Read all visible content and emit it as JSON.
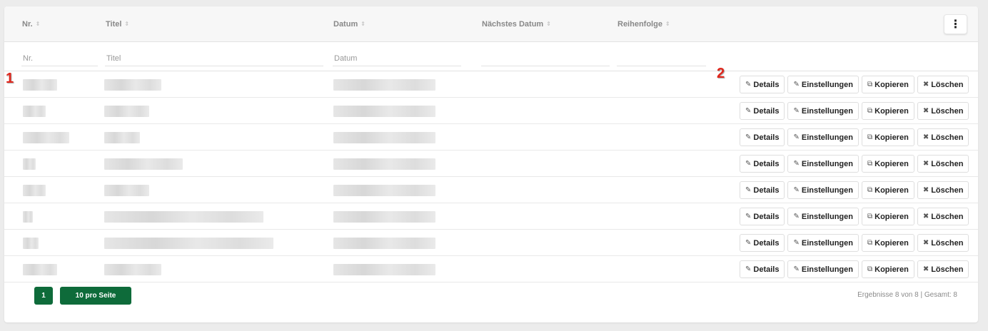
{
  "table": {
    "columns": [
      {
        "key": "nr",
        "label": "Nr.",
        "sort_icon": "sort-icon"
      },
      {
        "key": "titel",
        "label": "Titel",
        "sort_icon": "sort-icon"
      },
      {
        "key": "datum",
        "label": "Datum",
        "sort_icon": "sort-icon"
      },
      {
        "key": "naechstes",
        "label": "Nächstes Datum",
        "sort_icon": "sort-icon"
      },
      {
        "key": "reihenfolge",
        "label": "Reihenfolge",
        "sort_icon": "sort-icon"
      }
    ],
    "menu_icon": "vertical-dots-icon",
    "filters": {
      "nr_placeholder": "Nr.",
      "titel_placeholder": "Titel",
      "datum_placeholder": "Datum"
    },
    "row_count": 8,
    "actions": {
      "details": "Details",
      "einstellungen": "Einstellungen",
      "kopieren": "Kopieren",
      "loeschen": "Löschen"
    }
  },
  "annotations": {
    "marker_1": "1",
    "marker_2": "2"
  },
  "footer": {
    "page": "1",
    "per_page": "10 pro Seite",
    "summary": "Ergebnisse 8 von 8 | Gesamt: 8"
  },
  "colors": {
    "accent": "#0e6b3a",
    "marker": "#e0261c"
  }
}
